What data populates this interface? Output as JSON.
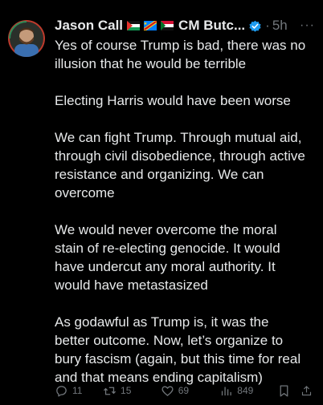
{
  "author": {
    "display_name": "Jason Call",
    "second_name": "CM Butc...",
    "flags": [
      "palestine-flag",
      "congo-flag",
      "sudan-flag"
    ],
    "verified": true,
    "time": "5h",
    "more_icon": "more-dots-icon"
  },
  "tweet": {
    "paragraphs": [
      "Yes of course Trump is bad, there was no\nillusion that he would be terrible",
      "Electing Harris would have been worse",
      "We can fight Trump. Through mutual aid,\nthrough civil disobedience, through active\nresistance and organizing. We can\novercome",
      "We would never overcome the moral\nstain of re-electing genocide. It would\nhave undercut any moral authority. It\nwould have metastasized",
      "As godawful as Trump is, it was the\nbetter outcome. Now, let’s organize to\nbury fascism (again, but this time for real\nand that means ending capitalism)"
    ]
  },
  "actions": {
    "reply_count": "11",
    "repost_count": "15",
    "like_count": "69",
    "view_count": "849"
  },
  "colors": {
    "background": "#000000",
    "text": "#e7e9ea",
    "muted": "#71767b",
    "verified_blue": "#1d9bf0"
  }
}
